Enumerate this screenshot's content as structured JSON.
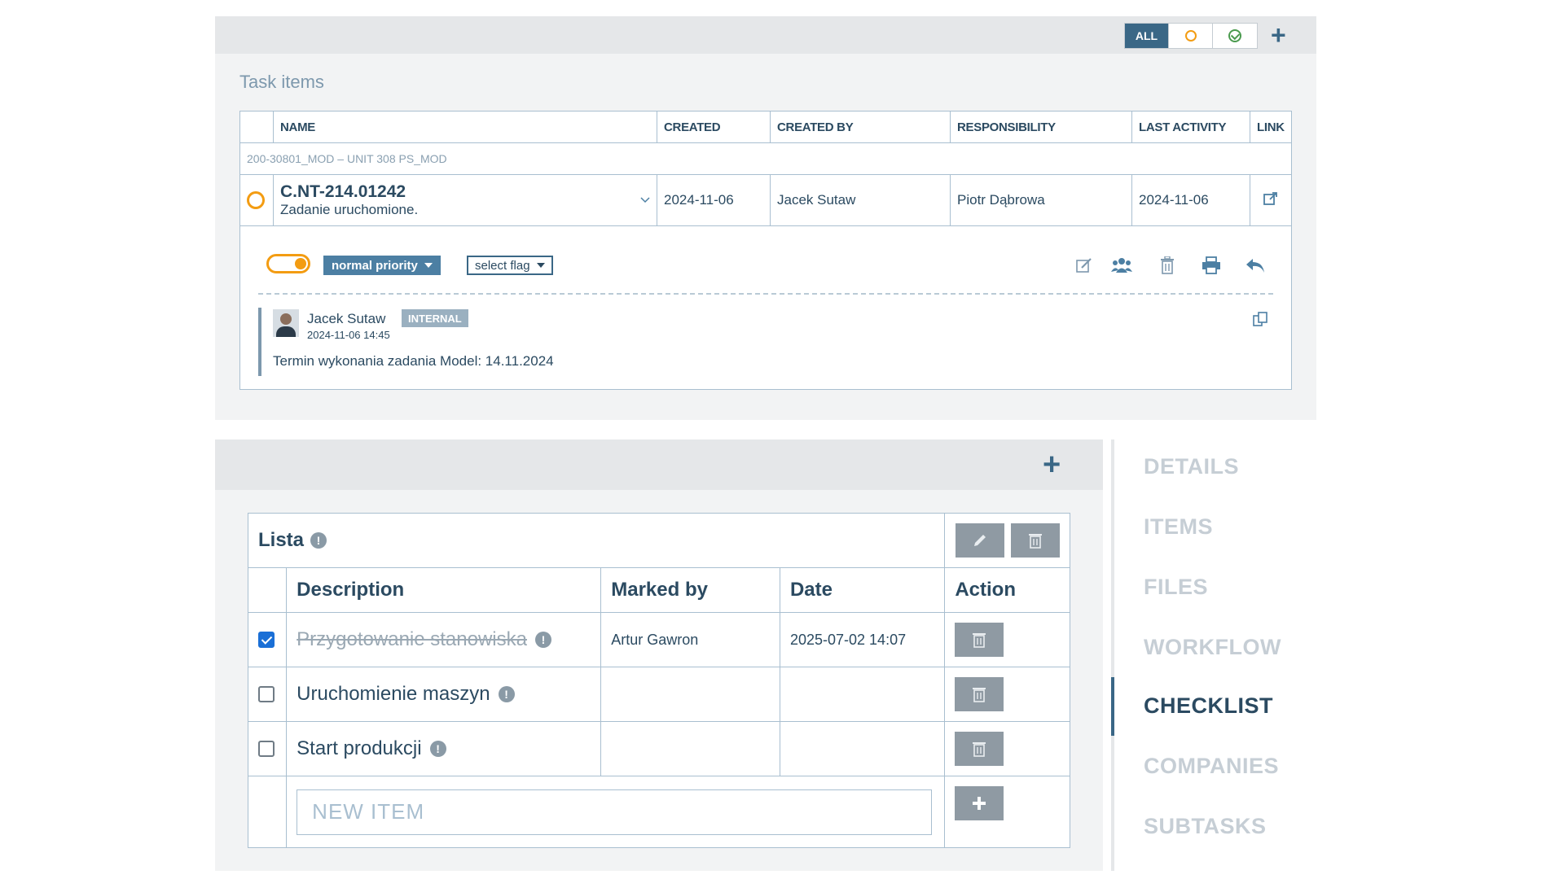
{
  "task_panel": {
    "filters": {
      "all": "ALL"
    },
    "title": "Task items",
    "columns": [
      "NAME",
      "CREATED",
      "CREATED BY",
      "RESPONSIBILITY",
      "LAST ACTIVITY",
      "LINK"
    ],
    "group_label": "200-30801_MOD – UNIT 308 PS_MOD",
    "task": {
      "code": "C.NT-214.01242",
      "status_text": "Zadanie uruchomione.",
      "created": "2024-11-06",
      "created_by": "Jacek Sutaw",
      "responsibility": "Piotr Dąbrowa",
      "last_activity": "2024-11-06"
    },
    "priority_label": "normal priority",
    "flag_label": "select flag",
    "comment": {
      "author": "Jacek Sutaw",
      "badge": "INTERNAL",
      "date": "2024-11-06 14:45",
      "text": "Termin wykonania zadania Model: 14.11.2024"
    }
  },
  "checklist": {
    "list_title": "Lista",
    "columns": {
      "description": "Description",
      "marked_by": "Marked by",
      "date": "Date",
      "action": "Action"
    },
    "items": [
      {
        "description": "Przygotowanie stanowiska",
        "checked": true,
        "marked_by": "Artur Gawron",
        "date": "2025-07-02 14:07"
      },
      {
        "description": "Uruchomienie maszyn",
        "checked": false,
        "marked_by": "",
        "date": ""
      },
      {
        "description": "Start produkcji",
        "checked": false,
        "marked_by": "",
        "date": ""
      }
    ],
    "new_item_placeholder": "NEW ITEM"
  },
  "nav": {
    "items": [
      "DETAILS",
      "ITEMS",
      "FILES",
      "WORKFLOW",
      "CHECKLIST",
      "COMPANIES",
      "SUBTASKS"
    ],
    "active": "CHECKLIST"
  },
  "colors": {
    "accent": "#3a6786",
    "pending": "#f39c12",
    "done": "#4a9a4e",
    "border": "#a9bfd0"
  }
}
